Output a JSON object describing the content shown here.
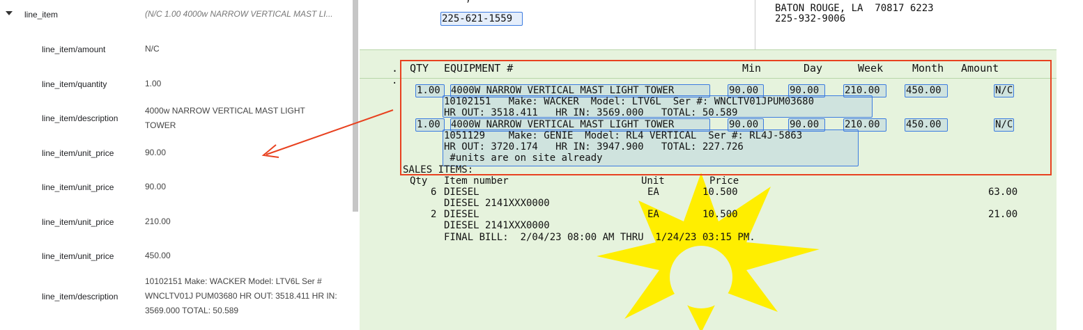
{
  "fields": [
    {
      "key": "line_item",
      "value": "(N/C 1.00 4000w NARROW VERTICAL MAST LI..."
    },
    {
      "key": "line_item/amount",
      "value": "N/C"
    },
    {
      "key": "line_item/quantity",
      "value": "1.00"
    },
    {
      "key": "line_item/description",
      "value": "4000w NARROW VERTICAL MAST LIGHT TOWER"
    },
    {
      "key": "line_item/unit_price",
      "value": "90.00"
    },
    {
      "key": "line_item/unit_price",
      "value": "90.00"
    },
    {
      "key": "line_item/unit_price",
      "value": "210.00"
    },
    {
      "key": "line_item/unit_price",
      "value": "450.00"
    },
    {
      "key": "line_item/description",
      "value": "10102151 Make: WACKER Model: LTV6L Ser # WNCLTV01J PUM03680 HR OUT: 3518.411 HR IN: 3569.000 TOTAL: 50.589"
    }
  ],
  "doc": {
    "top_partial": "-- -, -- -----",
    "phone_left": "225-621-1559",
    "addr_right": "BATON ROUGE, LA  70817 6223",
    "phone_right": "225-932-9006",
    "header": {
      "dot": ".",
      "qty": "QTY",
      "equipment": "EQUIPMENT #",
      "min": "Min",
      "day": "Day",
      "week": "Week",
      "month": "Month",
      "amount": "Amount"
    },
    "items": [
      {
        "qty": "1.00",
        "desc": "4000W NARROW VERTICAL MAST LIGHT TOWER",
        "min": "90.00",
        "day": "90.00",
        "week": "210.00",
        "month": "450.00",
        "amount": "N/C",
        "line2": "10102151   Make: WACKER  Model: LTV6L  Ser #: WNCLTV01JPUM03680",
        "line3": "HR OUT: 3518.411   HR IN: 3569.000   TOTAL: 50.589"
      },
      {
        "qty": "1.00",
        "desc": "4000W NARROW VERTICAL MAST LIGHT TOWER",
        "min": "90.00",
        "day": "90.00",
        "week": "210.00",
        "month": "450.00",
        "amount": "N/C",
        "line2": "1051129    Make: GENIE  Model: RL4 VERTICAL  Ser #: RL4J-5863",
        "line3": "HR OUT: 3720.174   HR IN: 3947.900   TOTAL: 227.726",
        "line4": " #units are on site already"
      }
    ],
    "sales_title": "SALES ITEMS:",
    "sales_header": {
      "qty": "Qty",
      "item": "Item number",
      "unit": "Unit",
      "price": "Price"
    },
    "sales": [
      {
        "qty": "6",
        "name": "DIESEL",
        "unit": "EA",
        "price": "10.500",
        "amount": "63.00",
        "sub": "DIESEL 2141XXX0000"
      },
      {
        "qty": "2",
        "name": "DIESEL",
        "unit": "EA",
        "price": "10.500",
        "amount": "21.00",
        "sub": "DIESEL 2141XXX0000"
      }
    ],
    "final_bill": "FINAL BILL:  2/04/23 08:00 AM THRU  1/24/23 03:15 PM."
  },
  "colors": {
    "highlight": "#3b7be0",
    "red_box": "#e8411f",
    "burst": "#ffee00",
    "doc_bg": "#e6f3dd"
  }
}
